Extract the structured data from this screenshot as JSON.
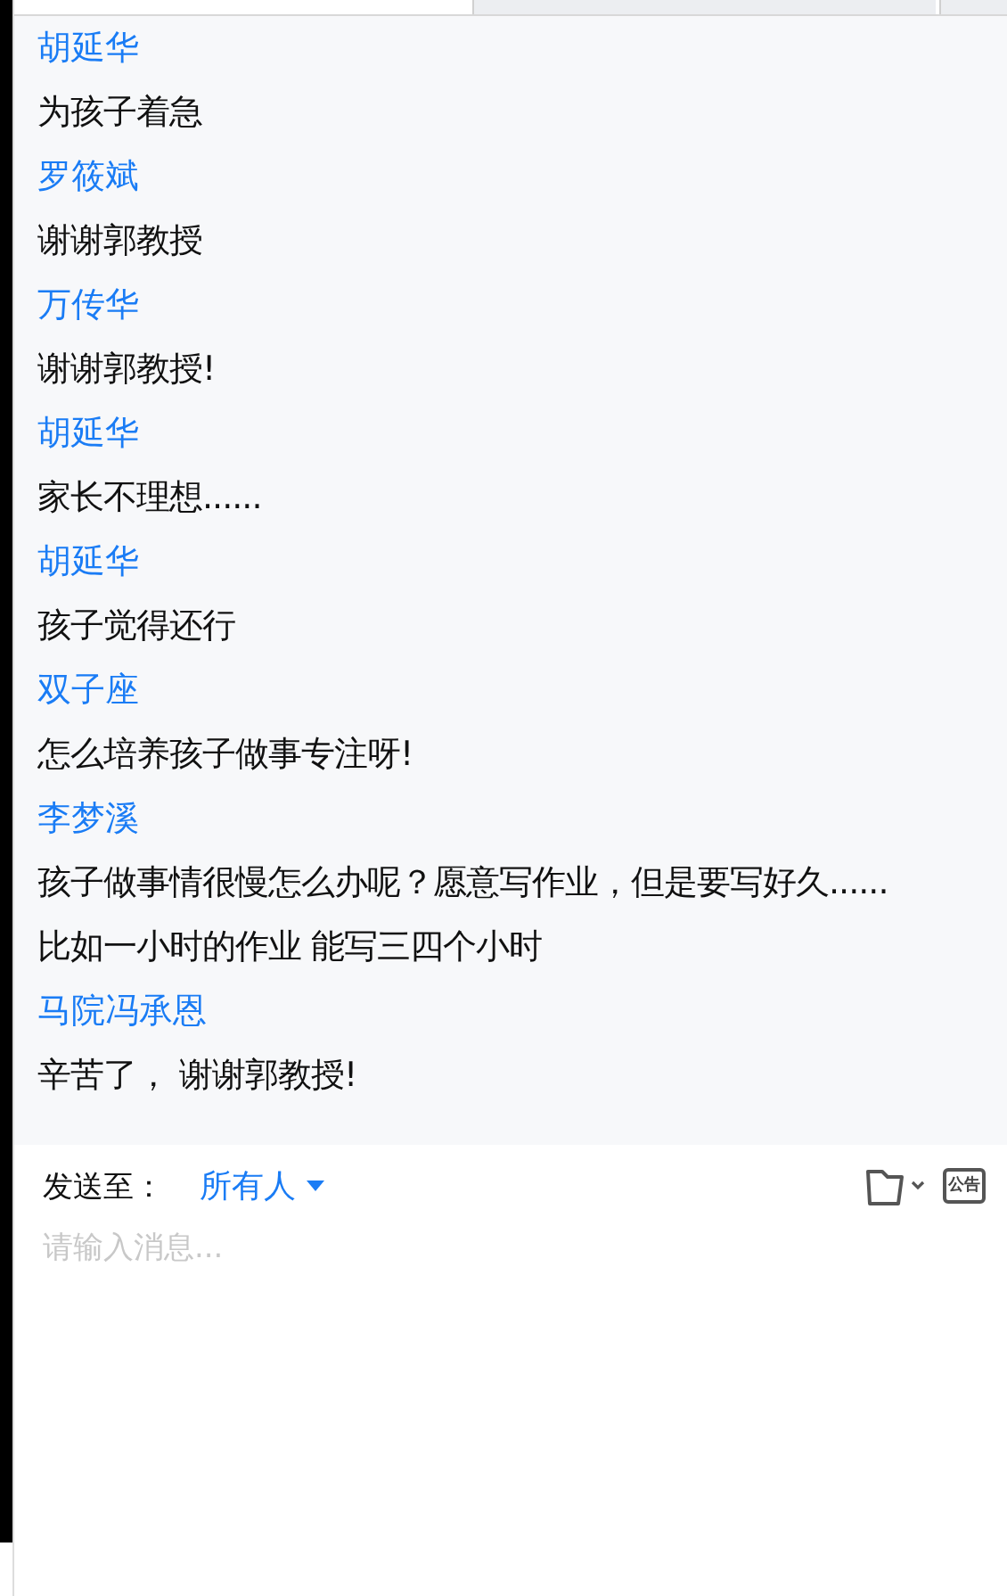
{
  "messages": [
    {
      "sender": "胡延华",
      "lines": [
        "为孩子着急"
      ]
    },
    {
      "sender": "罗筱斌",
      "lines": [
        "谢谢郭教授"
      ]
    },
    {
      "sender": "万传华",
      "lines": [
        "谢谢郭教授!"
      ]
    },
    {
      "sender": "胡延华",
      "lines": [
        "家长不理想......"
      ]
    },
    {
      "sender": "胡延华",
      "lines": [
        "孩子觉得还行"
      ]
    },
    {
      "sender": "双子座",
      "lines": [
        "怎么培养孩子做事专注呀!"
      ]
    },
    {
      "sender": "李梦溪",
      "lines": [
        "孩子做事情很慢怎么办呢？愿意写作业，但是要写好久......",
        "比如一小时的作业 能写三四个小时"
      ]
    },
    {
      "sender": "马院冯承恩",
      "lines": [
        "辛苦了， 谢谢郭教授!"
      ]
    }
  ],
  "composer": {
    "send_to_label": "发送至：",
    "recipient": "所有人",
    "notice_label": "公告",
    "placeholder": "请输入消息..."
  }
}
